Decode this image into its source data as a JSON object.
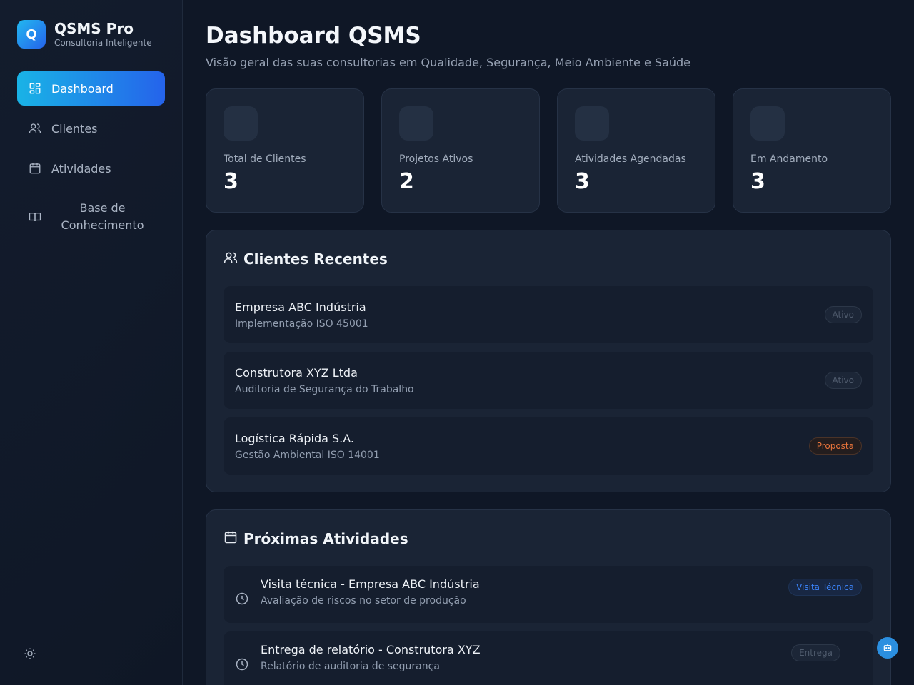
{
  "brand": {
    "logo_letter": "Q",
    "title": "QSMS Pro",
    "subtitle": "Consultoria Inteligente"
  },
  "sidebar": {
    "items": [
      {
        "label": "Dashboard",
        "icon": "dashboard-grid-icon",
        "active": true
      },
      {
        "label": "Clientes",
        "icon": "users-icon",
        "active": false
      },
      {
        "label": "Atividades",
        "icon": "calendar-icon",
        "active": false
      },
      {
        "label": "Base de Conhecimento",
        "icon": "book-open-icon",
        "active": false
      }
    ],
    "theme_toggle_icon": "sun-icon"
  },
  "header": {
    "title": "Dashboard QSMS",
    "subtitle": "Visão geral das suas consultorias em Qualidade, Segurança, Meio Ambiente e Saúde"
  },
  "stats": [
    {
      "label": "Total de Clientes",
      "value": "3"
    },
    {
      "label": "Projetos Ativos",
      "value": "2"
    },
    {
      "label": "Atividades Agendadas",
      "value": "3"
    },
    {
      "label": "Em Andamento",
      "value": "3"
    }
  ],
  "recent_clients": {
    "title": "Clientes Recentes",
    "icon": "users-icon",
    "items": [
      {
        "name": "Empresa ABC Indústria",
        "detail": "Implementação ISO 45001",
        "status": "Ativo"
      },
      {
        "name": "Construtora XYZ Ltda",
        "detail": "Auditoria de Segurança do Trabalho",
        "status": "Ativo"
      },
      {
        "name": "Logística Rápida S.A.",
        "detail": "Gestão Ambiental ISO 14001",
        "status": "Proposta"
      }
    ]
  },
  "upcoming": {
    "title": "Próximas Atividades",
    "icon": "calendar-icon",
    "items": [
      {
        "title": "Visita técnica - Empresa ABC Indústria",
        "detail": "Avaliação de riscos no setor de produção",
        "tag": "Visita Técnica"
      },
      {
        "title": "Entrega de relatório - Construtora XYZ",
        "detail": "Relatório de auditoria de segurança",
        "tag": "Entrega"
      }
    ]
  },
  "colors": {
    "accent_start": "#19b3e6",
    "accent_end": "#2563eb",
    "proposal": "#e8743b",
    "visit": "#3b82f6"
  },
  "fab_icon": "bot-icon"
}
